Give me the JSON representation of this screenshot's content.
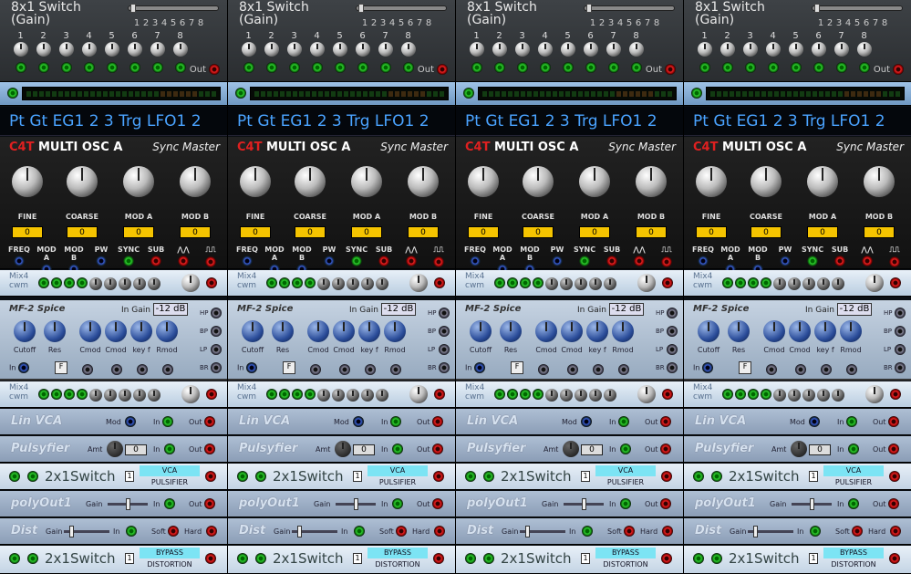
{
  "switch8": {
    "title_line1": "8x1 Switch",
    "title_line2": "(Gain)",
    "channels": [
      "1",
      "2",
      "3",
      "4",
      "5",
      "6",
      "7",
      "8"
    ],
    "out_label": "Out"
  },
  "label_strip": "Pt Gt EG1 2 3 Trg LFO1 2",
  "osc": {
    "brand": "C4T",
    "name": "MULTI OSC A",
    "sync": "Sync Master",
    "knobs": [
      {
        "label": "FINE",
        "value": "0"
      },
      {
        "label": "COARSE",
        "value": "0"
      },
      {
        "label": "MOD A",
        "value": "0"
      },
      {
        "label": "MOD B",
        "value": "0"
      }
    ],
    "mod_inputs": [
      "FREQ",
      "MOD A",
      "MOD B",
      "PW",
      "SYNC",
      "SUB",
      "⋀⋀",
      "⎍⎍"
    ]
  },
  "mix": {
    "line1": "Mix4",
    "line2": "cwm"
  },
  "mf2": {
    "name": "MF-2 Spice",
    "in_gain_label": "In Gain",
    "in_gain_value": "-12 dB",
    "knobs": [
      "Cutoff",
      "Res",
      "Cmod",
      "Cmod",
      "key f",
      "Rmod"
    ],
    "in_label": "In",
    "outputs": [
      "HP",
      "BP",
      "LP",
      "BR"
    ]
  },
  "linvca": {
    "name": "Lin VCA",
    "mod": "Mod",
    "in": "In",
    "out": "Out"
  },
  "pulsyfier": {
    "name": "Pulsyfier",
    "amt": "Amt",
    "value": "0",
    "in": "In",
    "out": "Out"
  },
  "switch_a": {
    "name": "2x1Switch",
    "num": "1",
    "opt1": "VCA",
    "opt2": "PULSIFIER"
  },
  "polyout": {
    "name": "polyOut1",
    "gain": "Gain",
    "in": "In",
    "out": "Out"
  },
  "dist": {
    "name": "Dist",
    "gain": "Gain",
    "in": "In",
    "soft": "Soft",
    "hard": "Hard"
  },
  "switch_b": {
    "name": "2x1Switch",
    "num": "1",
    "opt1": "BYPASS",
    "opt2": "DISTORTION"
  }
}
